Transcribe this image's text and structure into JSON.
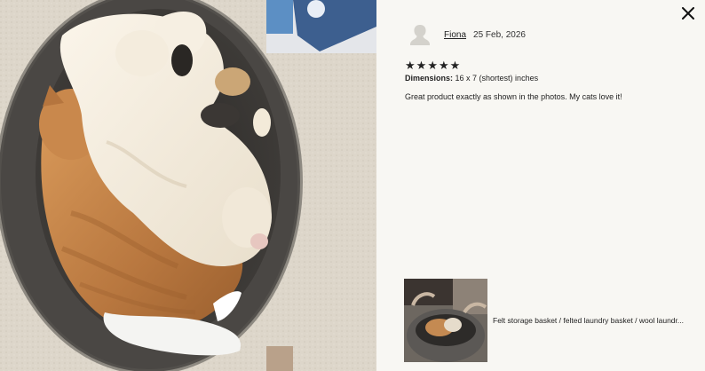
{
  "review": {
    "reviewer_name": "Fiona",
    "date": "25 Feb, 2026",
    "rating": 5,
    "stars": [
      "★",
      "★",
      "★",
      "★",
      "★"
    ],
    "dimensions_label": "Dimensions:",
    "dimensions_value": "16 x 7 (shortest) inches",
    "text": "Great product exactly as shown in the photos. My cats love it!"
  },
  "product": {
    "title": "Felt storage basket / felted laundry basket / wool laundr..."
  },
  "icons": {
    "close": "close-icon",
    "avatar": "person-silhouette-icon",
    "star": "star-icon"
  },
  "colors": {
    "panel_bg": "#f8f7f3",
    "text": "#222222",
    "basket": "#4a4744",
    "cream_cat": "#f3ead9",
    "ginger_cat": "#c98a4e"
  }
}
